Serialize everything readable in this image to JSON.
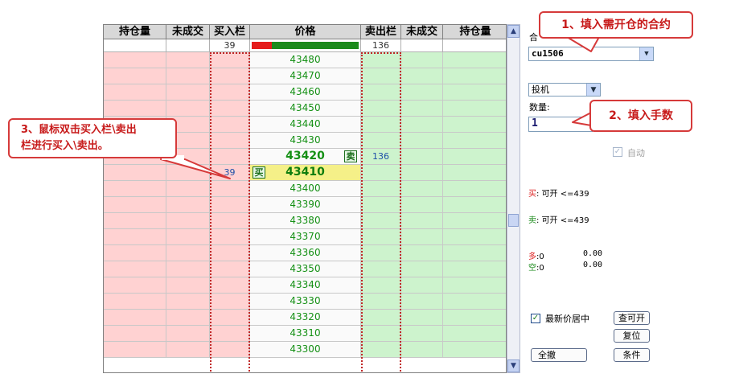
{
  "headers": [
    "持仓量",
    "未成交",
    "买入栏",
    "价格",
    "卖出栏",
    "未成交",
    "持仓量"
  ],
  "summary": {
    "buy_total": "39",
    "sell_total": "136",
    "pressure_red_fraction": 0.19
  },
  "prices": [
    "43480",
    "43470",
    "43460",
    "43450",
    "43440",
    "43430",
    "43420",
    "43410",
    "43400",
    "43390",
    "43380",
    "43370",
    "43360",
    "43350",
    "43340",
    "43330",
    "43320",
    "43310",
    "43300"
  ],
  "last_price": "43420",
  "sell_tag": "卖",
  "sell_qty": "136",
  "ask_price": "43410",
  "buy_tag": "买",
  "buy_qty": "39",
  "panel": {
    "contract_label": "合",
    "contract_value": "cu1506",
    "order_type": "投机",
    "qty_label": "数量:",
    "qty_value": "1",
    "auto_label": "自动",
    "buy_label": "买",
    "buy_open": ": 可开 <=439",
    "sell_label": "卖",
    "sell_open": ": 可开 <=439",
    "long_label": "多",
    "long_value": ":0",
    "long_amount": "0.00",
    "short_label": "空",
    "short_value": ":0",
    "short_amount": "0.00",
    "center_label": "最新价居中",
    "query_btn": "查可开",
    "reset_btn": "复位",
    "cancel_all_btn": "全撤",
    "condition_btn": "条件"
  },
  "callouts": {
    "c1": "1、填入需开仓的合约",
    "c2": "2、填入手数",
    "c3_line1": "3、鼠标双击买入栏\\卖出",
    "c3_line2": "栏进行买入\\卖出。"
  },
  "colors": {
    "hold_bg": "#ffd2d2",
    "sell_side_bg": "#cdf3cd",
    "price_green": "#159015",
    "ask_highlight": "#f5f088",
    "callout_red": "#d63a3a"
  }
}
